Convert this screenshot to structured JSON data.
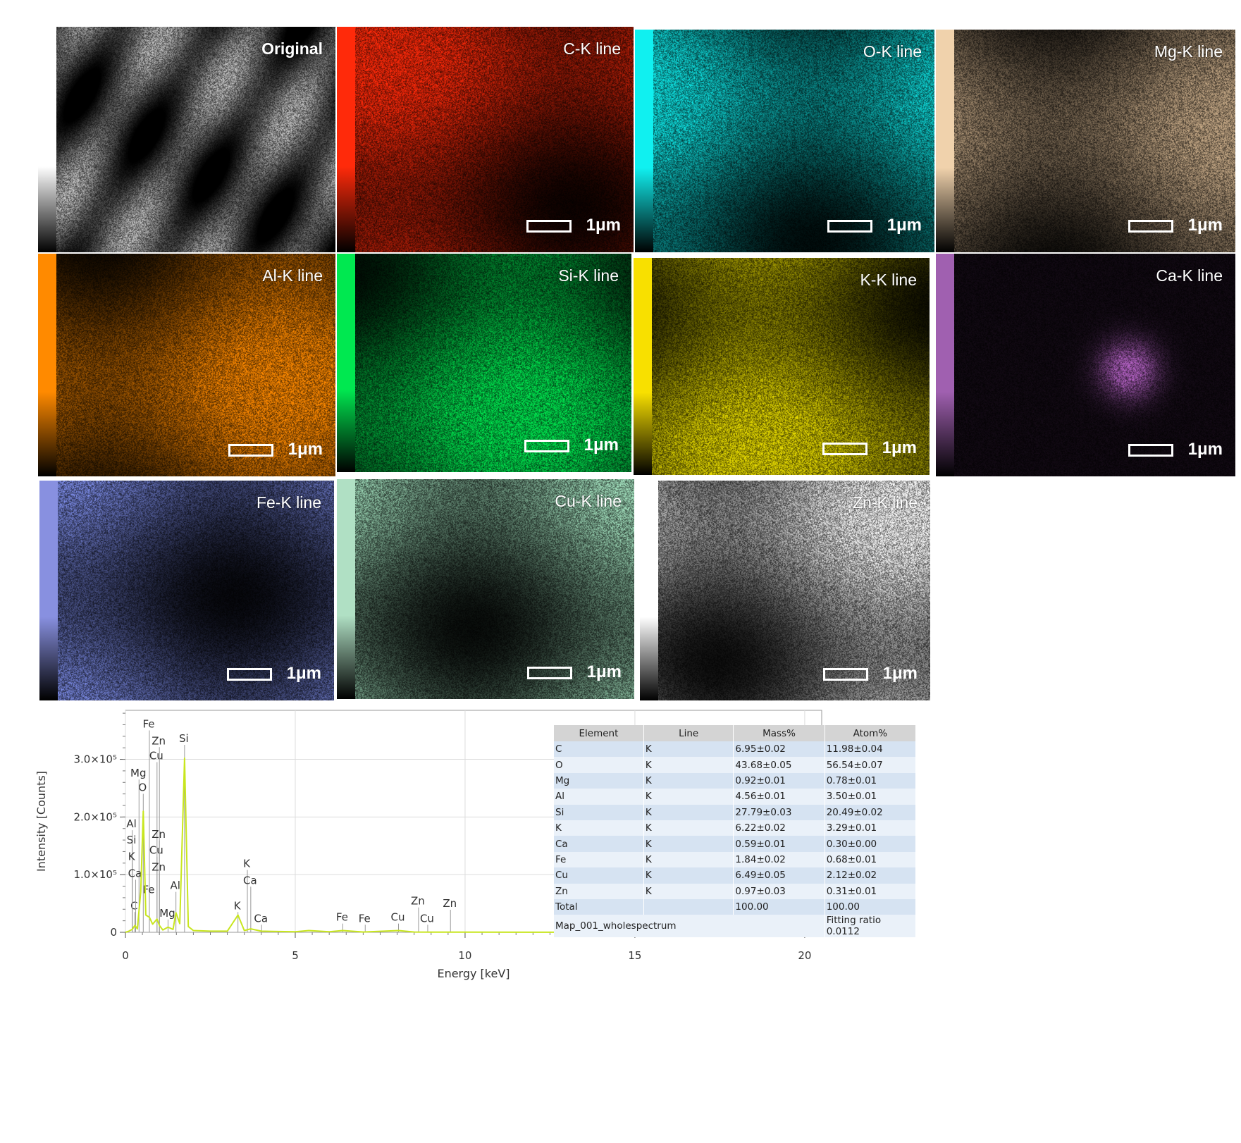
{
  "maps": [
    {
      "id": "original",
      "label": "Original",
      "color": "#c8c8c8",
      "bar_top": "#ffffff",
      "scale": ""
    },
    {
      "id": "c",
      "label": "C-K line",
      "color": "#ff2a0a",
      "bar_top": "#ff2a0a",
      "scale": "1μm"
    },
    {
      "id": "o",
      "label": "O-K line",
      "color": "#10e8e8",
      "bar_top": "#10f0f0",
      "scale": "1μm"
    },
    {
      "id": "mg",
      "label": "Mg-K line",
      "color": "#c8ab88",
      "bar_top": "#f0d2ac",
      "scale": "1μm"
    },
    {
      "id": "al",
      "label": "Al-K line",
      "color": "#ff8a00",
      "bar_top": "#ff8a00",
      "scale": "1μm"
    },
    {
      "id": "si",
      "label": "Si-K line",
      "color": "#00e850",
      "bar_top": "#00e850",
      "scale": "1μm"
    },
    {
      "id": "k",
      "label": "K-K line",
      "color": "#e8dc00",
      "bar_top": "#f8e000",
      "scale": "1μm"
    },
    {
      "id": "ca",
      "label": "Ca-K line",
      "color": "#b060c0",
      "bar_top": "#a060b0",
      "scale": "1μm"
    },
    {
      "id": "fe",
      "label": "Fe-K line",
      "color": "#8090ee",
      "bar_top": "#8890e0",
      "scale": "1μm"
    },
    {
      "id": "cu",
      "label": "Cu-K line",
      "color": "#a8e8c4",
      "bar_top": "#b0e0c4",
      "scale": "1μm"
    },
    {
      "id": "zn",
      "label": "Zn-K line",
      "color": "#ffffff",
      "bar_top": "#ffffff",
      "scale": "1μm"
    }
  ],
  "chart_data": {
    "type": "line",
    "xlabel": "Energy [keV]",
    "ylabel": "Intensity [Counts]",
    "xlim": [
      0,
      20.5
    ],
    "ylim": [
      0,
      385000
    ],
    "x_ticks": [
      "0",
      "5",
      "10",
      "15",
      "20"
    ],
    "y_ticks": [
      {
        "value": 0,
        "label": "0"
      },
      {
        "value": 100000,
        "label": "1.0×10⁵"
      },
      {
        "value": 200000,
        "label": "2.0×10⁵"
      },
      {
        "value": 300000,
        "label": "3.0×10⁵"
      }
    ],
    "series": [
      {
        "color": "#c8e61e",
        "x": [
          0,
          0.1,
          0.2,
          0.277,
          0.35,
          0.45,
          0.525,
          0.6,
          0.705,
          0.8,
          0.93,
          1.0,
          1.1,
          1.254,
          1.4,
          1.487,
          1.6,
          1.74,
          1.85,
          2.0,
          2.5,
          3.0,
          3.313,
          3.5,
          3.69,
          4.0,
          5.0,
          5.4,
          6.0,
          6.4,
          7.0,
          8.04,
          8.5,
          9.0,
          10.0,
          12.0,
          15.0,
          18.0,
          20.5
        ],
        "y": [
          0,
          2000,
          5000,
          12000,
          6000,
          70000,
          210000,
          30000,
          26000,
          14000,
          23000,
          12000,
          4000,
          9000,
          5000,
          34000,
          15000,
          302000,
          10000,
          3000,
          2000,
          2000,
          30000,
          3000,
          6000,
          2000,
          1000,
          3000,
          1000,
          3000,
          500,
          3000,
          500,
          300,
          200,
          100,
          100,
          100,
          100
        ]
      }
    ],
    "peak_labels": [
      {
        "text": "C",
        "energy": 0.277,
        "height": 40000
      },
      {
        "text": "O",
        "energy": 0.525,
        "height": 245000
      },
      {
        "text": "Mg",
        "energy": 1.254,
        "height": 27000
      },
      {
        "text": "Mg",
        "energy": 0.4,
        "height": 270000
      },
      {
        "text": "Al",
        "energy": 1.487,
        "height": 75000
      },
      {
        "text": "Al",
        "energy": 0.2,
        "height": 182000
      },
      {
        "text": "Si",
        "energy": 1.74,
        "height": 330000
      },
      {
        "text": "Si",
        "energy": 0.2,
        "height": 154000
      },
      {
        "text": "K",
        "energy": 3.313,
        "height": 40000
      },
      {
        "text": "K",
        "energy": 3.59,
        "height": 113000
      },
      {
        "text": "K",
        "energy": 0.2,
        "height": 125000
      },
      {
        "text": "Ca",
        "energy": 3.69,
        "height": 84000
      },
      {
        "text": "Ca",
        "energy": 4.01,
        "height": 18000
      },
      {
        "text": "Ca",
        "energy": 0.3,
        "height": 96000
      },
      {
        "text": "Fe",
        "energy": 0.705,
        "height": 355000
      },
      {
        "text": "Fe",
        "energy": 0.705,
        "height": 68000
      },
      {
        "text": "Fe",
        "energy": 6.4,
        "height": 20000
      },
      {
        "text": "Fe",
        "energy": 7.06,
        "height": 18000
      },
      {
        "text": "Cu",
        "energy": 0.93,
        "height": 300000
      },
      {
        "text": "Cu",
        "energy": 0.93,
        "height": 136000
      },
      {
        "text": "Cu",
        "energy": 8.04,
        "height": 20000
      },
      {
        "text": "Cu",
        "energy": 8.9,
        "height": 18000
      },
      {
        "text": "Zn",
        "energy": 1.0,
        "height": 326000
      },
      {
        "text": "Zn",
        "energy": 1.0,
        "height": 164000
      },
      {
        "text": "Zn",
        "energy": 1.0,
        "height": 107000
      },
      {
        "text": "Zn",
        "energy": 8.63,
        "height": 48000
      },
      {
        "text": "Zn",
        "energy": 9.57,
        "height": 44000
      }
    ]
  },
  "quant_table": {
    "headers": [
      "Element",
      "Line",
      "Mass%",
      "Atom%"
    ],
    "rows": [
      [
        "C",
        "K",
        "6.95±0.02",
        "11.98±0.04"
      ],
      [
        "O",
        "K",
        "43.68±0.05",
        "56.54±0.07"
      ],
      [
        "Mg",
        "K",
        "0.92±0.01",
        "0.78±0.01"
      ],
      [
        "Al",
        "K",
        "4.56±0.01",
        "3.50±0.01"
      ],
      [
        "Si",
        "K",
        "27.79±0.03",
        "20.49±0.02"
      ],
      [
        "K",
        "K",
        "6.22±0.02",
        "3.29±0.01"
      ],
      [
        "Ca",
        "K",
        "0.59±0.01",
        "0.30±0.00"
      ],
      [
        "Fe",
        "K",
        "1.84±0.02",
        "0.68±0.01"
      ],
      [
        "Cu",
        "K",
        "6.49±0.05",
        "2.12±0.02"
      ],
      [
        "Zn",
        "K",
        "0.97±0.03",
        "0.31±0.01"
      ],
      [
        "Total",
        "",
        "100.00",
        "100.00"
      ]
    ],
    "footer_left": "Map_001_wholespectrum",
    "footer_right": "Fitting ratio 0.0112"
  }
}
